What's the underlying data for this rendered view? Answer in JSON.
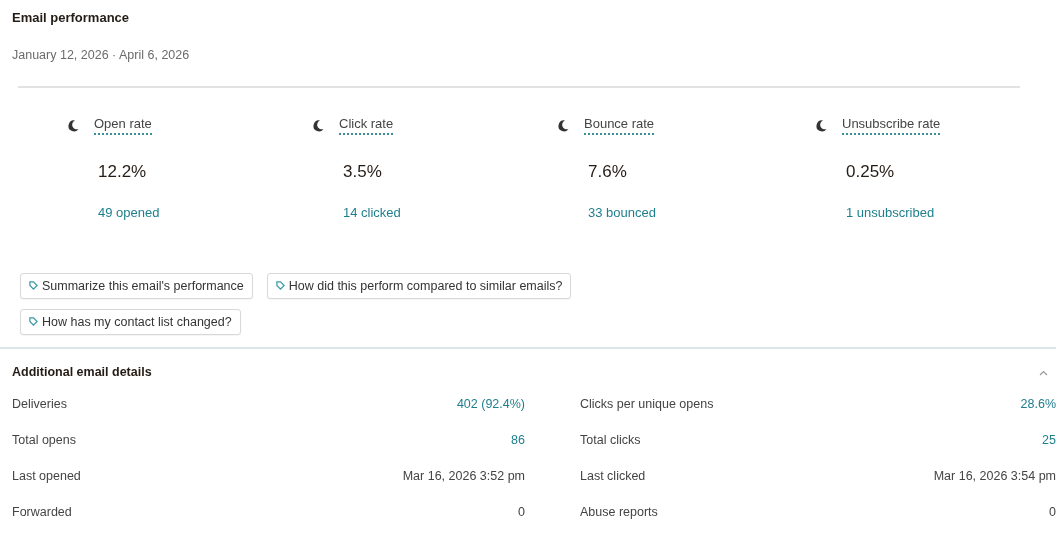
{
  "title": "Email performance",
  "date_range": "January 12, 2026 · April 6, 2026",
  "metrics": [
    {
      "label": "Open rate",
      "value": "12.2%",
      "detail": "49 opened"
    },
    {
      "label": "Click rate",
      "value": "3.5%",
      "detail": "14 clicked"
    },
    {
      "label": "Bounce rate",
      "value": "7.6%",
      "detail": "33 bounced"
    },
    {
      "label": "Unsubscribe rate",
      "value": "0.25%",
      "detail": "1 unsubscribed"
    }
  ],
  "prompts": [
    "Summarize this email's performance",
    "How did this perform compared to similar emails?",
    "How has my contact list changed?"
  ],
  "details": {
    "title": "Additional email details",
    "expanded": true,
    "columns": [
      [
        {
          "label": "Deliveries",
          "value": "402 (92.4%)",
          "link": true
        },
        {
          "label": "Total opens",
          "value": "86",
          "link": true
        },
        {
          "label": "Last opened",
          "value": "Mar 16, 2026 3:52 pm",
          "link": false
        },
        {
          "label": "Forwarded",
          "value": "0",
          "link": false
        }
      ],
      [
        {
          "label": "Clicks per unique opens",
          "value": "28.6%",
          "link": true
        },
        {
          "label": "Total clicks",
          "value": "25",
          "link": true
        },
        {
          "label": "Last clicked",
          "value": "Mar 16, 2026 3:54 pm",
          "link": false
        },
        {
          "label": "Abuse reports",
          "value": "0",
          "link": false
        }
      ]
    ]
  }
}
